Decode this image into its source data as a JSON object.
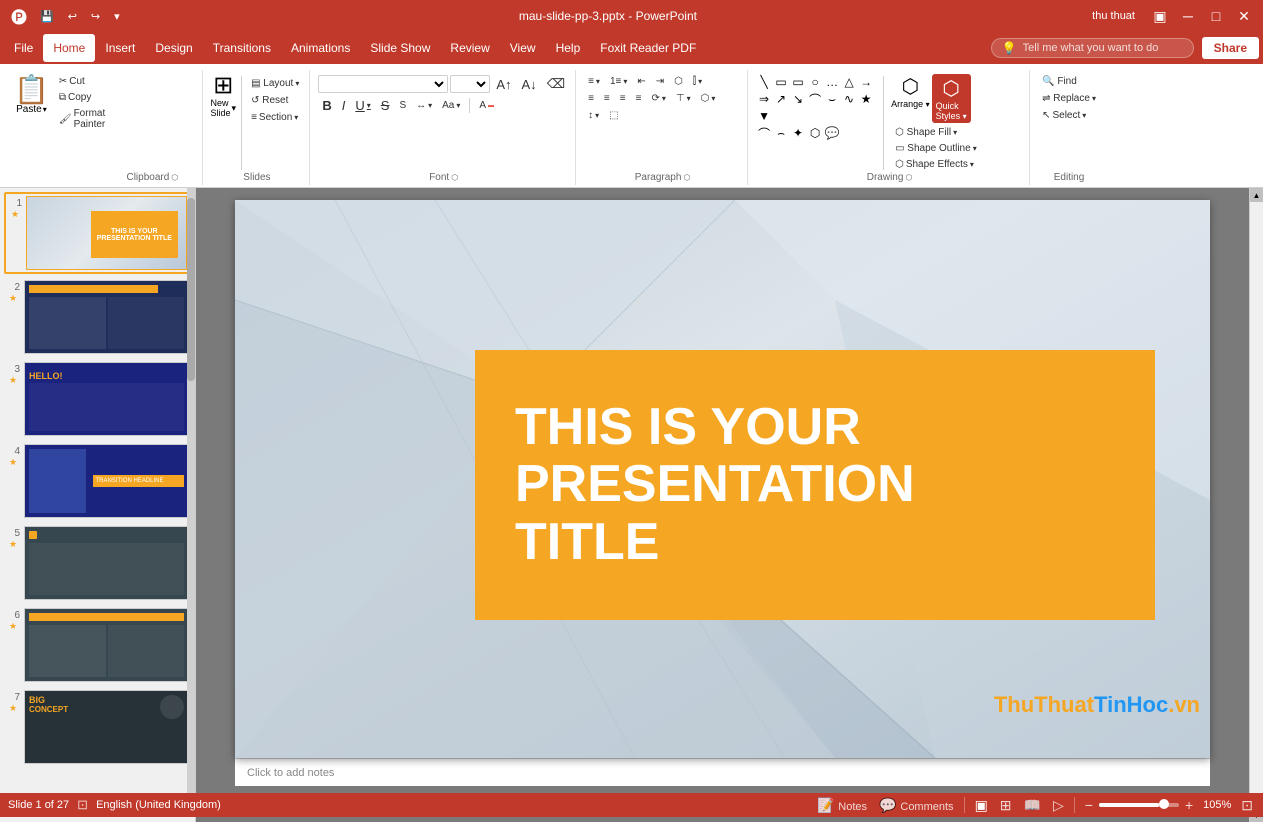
{
  "titlebar": {
    "filename": "mau-slide-pp-3.pptx - PowerPoint",
    "user": "thu thuat",
    "quickaccess": [
      "save",
      "undo",
      "redo",
      "customize"
    ]
  },
  "menubar": {
    "items": [
      "File",
      "Home",
      "Insert",
      "Design",
      "Transitions",
      "Animations",
      "Slide Show",
      "Review",
      "View",
      "Help",
      "Foxit Reader PDF"
    ],
    "active": "Home",
    "tellme": "Tell me what you want to do",
    "share": "Share"
  },
  "ribbon": {
    "groups": [
      {
        "name": "Clipboard",
        "label": "Clipboard",
        "buttons": [
          "Paste",
          "Cut",
          "Copy",
          "Format Painter"
        ]
      },
      {
        "name": "Slides",
        "label": "Slides",
        "buttons": [
          "New Slide",
          "Layout",
          "Reset",
          "Section"
        ]
      },
      {
        "name": "Font",
        "label": "Font",
        "fontname": "",
        "fontsize": ""
      },
      {
        "name": "Paragraph",
        "label": "Paragraph"
      },
      {
        "name": "Drawing",
        "label": "Drawing"
      },
      {
        "name": "Editing",
        "label": "Editing",
        "buttons": [
          "Find",
          "Replace",
          "Select"
        ]
      }
    ],
    "grouplabels": {
      "clipboard": "Clipboard",
      "slides": "Slides",
      "font": "Font",
      "paragraph": "Paragraph",
      "drawing": "Drawing",
      "editing": "Editing"
    },
    "styles_label": "Styles",
    "shape_label": "Shape",
    "shape_effects_label": "Shape Effects",
    "section_label": "Section",
    "select_label": "Select",
    "editing_label": "Editing"
  },
  "slides": [
    {
      "num": "1",
      "star": "★",
      "active": true
    },
    {
      "num": "2",
      "star": "★",
      "active": false
    },
    {
      "num": "3",
      "star": "★",
      "active": false
    },
    {
      "num": "4",
      "star": "★",
      "active": false
    },
    {
      "num": "5",
      "star": "★",
      "active": false
    },
    {
      "num": "6",
      "star": "★",
      "active": false
    },
    {
      "num": "7",
      "star": "★",
      "active": false
    }
  ],
  "mainslide": {
    "title_line1": "THIS IS YOUR",
    "title_line2": "PRESENTATION",
    "title_line3": "TITLE",
    "notes_placeholder": "Click to add notes"
  },
  "statusbar": {
    "slide_info": "Slide 1 of 27",
    "language": "English (United Kingdom)",
    "notes": "Notes",
    "comments": "Comments",
    "zoom": "105%",
    "fit_btn": "⊞"
  },
  "icons": {
    "save": "💾",
    "undo": "↩",
    "redo": "↪",
    "paste": "📋",
    "cut": "✂",
    "copy": "⧉",
    "format_painter": "🖌",
    "new_slide": "⊞",
    "bold": "B",
    "italic": "I",
    "underline": "U",
    "strikethrough": "S",
    "find": "🔍",
    "replace": "⇌",
    "chevron_down": "▾",
    "chevron_up": "▲",
    "lightbulb": "💡",
    "user": "👤",
    "notes_icon": "📝",
    "comments_icon": "💬",
    "normal_view": "▣",
    "slide_sorter": "⊞",
    "reading_view": "📖",
    "slide_show": "▷",
    "fit_slide": "⊡",
    "zoom_in": "+",
    "zoom_out": "-",
    "minus": "−",
    "plus": "+"
  },
  "watermark": {
    "text": "ThuThuatTinHoc.vn"
  }
}
